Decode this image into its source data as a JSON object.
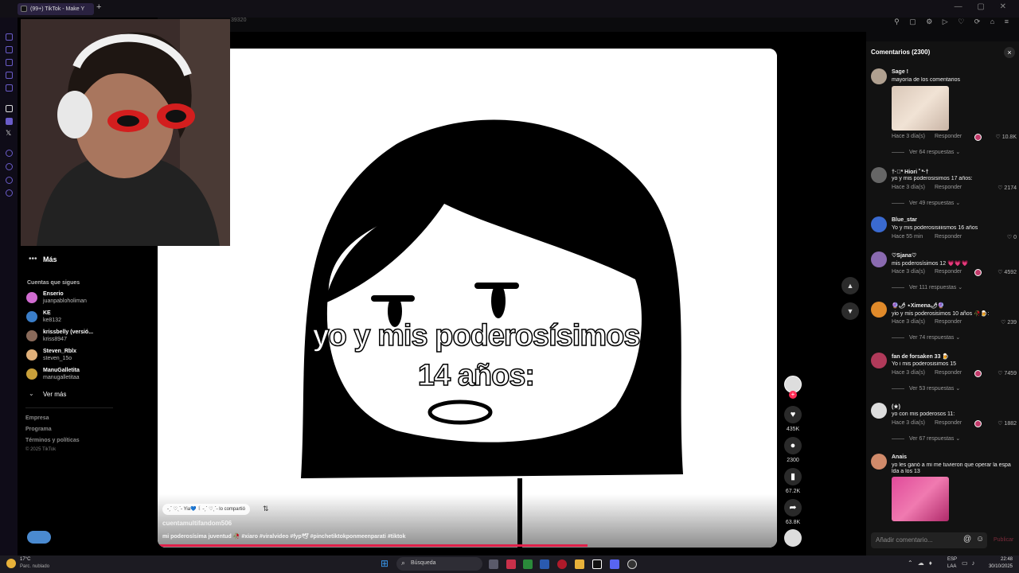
{
  "browser": {
    "tab_title": "(99+) TikTok - Make Y",
    "new_tab": "+",
    "window_controls": "— ▢ ✕",
    "url_fragment": "39320"
  },
  "sidebar": {
    "more_label": "Más",
    "following_header": "Cuentas que sigues",
    "accounts": [
      {
        "name": "Enserio",
        "handle": "juanpabloholiman",
        "color": "#d06bd0"
      },
      {
        "name": "KE",
        "handle": "ke8132",
        "color": "#3a7ec9"
      },
      {
        "name": "krissbelly (versió...",
        "handle": "kriss8947",
        "color": "#8a6a5a"
      },
      {
        "name": "Steven_Rblx",
        "handle": "steven_15o",
        "color": "#e0b07a"
      },
      {
        "name": "ManuGalletita",
        "handle": "manugalletitaa",
        "color": "#c9a03a"
      }
    ],
    "see_more": "Ver más",
    "footer": [
      "Empresa",
      "Programa",
      "Términos y políticas",
      "© 2025 TikTok"
    ]
  },
  "video": {
    "overlay_line1": "yo y mis poderosísimos",
    "overlay_line2": "14 años:",
    "shared_by": "˗ˏˋ ♡ˎˊ˗ Yia💙 ꒰ ˗ˏˋ ♡ˎˊ˗ lo compartió",
    "author": "cuentamultifandom506",
    "caption": "mi poderosísima juventud 🥀 #xiaro #viralvideo #fyp🕊 #pinchetiktokponmeenparati #tiktok"
  },
  "actions": {
    "likes": "435K",
    "comments": "2300",
    "saves": "67.2K",
    "shares": "63.8K"
  },
  "comments_panel": {
    "title": "Comentarios (2300)",
    "close": "×",
    "reply_label": "Responder",
    "input_placeholder": "Añadir comentario...",
    "publish": "Publicar",
    "items": [
      {
        "user": "Sage !",
        "text": "mayoría de los comentarios",
        "meta": "Hace 3 día(s)",
        "likes": "10.8K",
        "more": "Ver 64 respuestas",
        "color": "#b0a090"
      },
      {
        "user": "†·ﾟ* Hiori ﾟ*·†",
        "text": "yo y mis poderosisimos 17 años:",
        "meta": "Hace 3 día(s)",
        "likes": "2174",
        "more": "Ver 49 respuestas",
        "color": "#666"
      },
      {
        "user": "Blue_star",
        "text": "Yo y mis poderosisiiiismos 16 años",
        "meta": "Hace 55 min",
        "likes": "0",
        "more": "",
        "color": "#3a6ad0"
      },
      {
        "user": "♡Sjana♡",
        "text": "mis poderosísimos 12 💗💗💗",
        "meta": "Hace 3 día(s)",
        "likes": "4592",
        "more": "Ver 111 respuestas",
        "color": "#8a6ab0"
      },
      {
        "user": "🔮🌶 ⋆Ximena🌶🔮",
        "text": "yio y mis poderosisimos 10 años 🥀🍺:",
        "meta": "Hace 3 día(s)",
        "likes": "239",
        "more": "Ver 74 respuestas",
        "color": "#e08a2a"
      },
      {
        "user": "fan de forsaken 33 🍺",
        "text": "Yo i mis poderosisimos 15",
        "meta": "Hace 3 día(s)",
        "likes": "7459",
        "more": "Ver 53 respuestas",
        "color": "#b03a5a"
      },
      {
        "user": "(★)",
        "text": "yo con mis poderosos 11:",
        "meta": "Hace 3 día(s)",
        "likes": "1882",
        "more": "Ver 67 respuestas",
        "color": "#ddd"
      },
      {
        "user": "Anais",
        "text": "yo les ganó a mi me tuvieron que operar la espa",
        "text2": "lda a los 13",
        "meta": "",
        "likes": "",
        "more": "",
        "color": "#d08a6a"
      }
    ]
  },
  "taskbar": {
    "weather_temp": "17°C",
    "weather_desc": "Parc. nublado",
    "search": "Búsqueda",
    "lang1": "ESP",
    "lang2": "LAA",
    "time": "22:48",
    "date": "30/10/2025"
  }
}
